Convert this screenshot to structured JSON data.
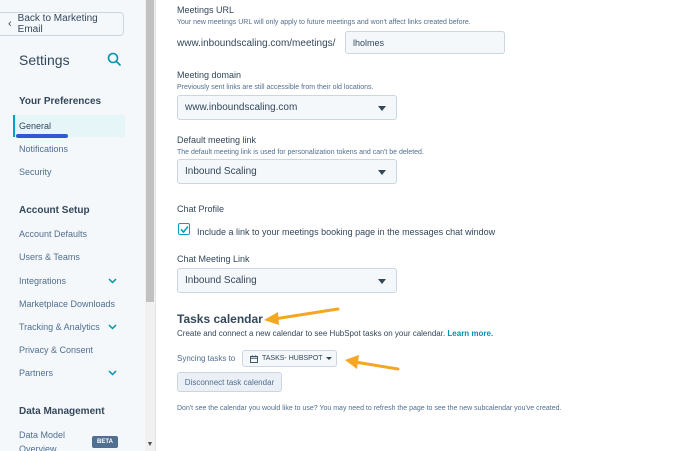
{
  "sidebar": {
    "back_label": "Back to Marketing Email",
    "title": "Settings",
    "sections": {
      "preferences": "Your Preferences",
      "account_setup": "Account Setup",
      "data_management": "Data Management"
    },
    "preferences_items": [
      "General",
      "Notifications",
      "Security"
    ],
    "account_items": [
      "Account Defaults",
      "Users & Teams",
      "Integrations",
      "Marketplace Downloads",
      "Tracking & Analytics",
      "Privacy & Consent",
      "Partners"
    ],
    "data_items": [
      "Data Model",
      "Overview"
    ],
    "beta_badge": "BETA"
  },
  "main": {
    "meetings_url": {
      "label": "Meetings URL",
      "help": "Your new meetings URL will only apply to future meetings and won't affect links created before.",
      "prefix": "www.inboundscaling.com/meetings/",
      "value": "lholmes"
    },
    "meeting_domain": {
      "label": "Meeting domain",
      "help": "Previously sent links are still accessible from their old locations.",
      "value": "www.inboundscaling.com"
    },
    "default_link": {
      "label": "Default meeting link",
      "help": "The default meeting link is used for personalization tokens and can't be deleted.",
      "value": "Inbound Scaling"
    },
    "chat_profile": {
      "label": "Chat Profile",
      "checkbox_label": "Include a link to your meetings booking page in the messages chat window",
      "checked": true
    },
    "chat_link": {
      "label": "Chat Meeting Link",
      "value": "Inbound Scaling"
    },
    "tasks": {
      "title": "Tasks calendar",
      "desc": "Create and connect a new calendar to see HubSpot tasks on your calendar.",
      "learn_more": "Learn more.",
      "sync_label": "Syncing tasks to",
      "calendar_value": "TASKS- HUBSPOT",
      "disconnect_label": "Disconnect task calendar",
      "footnote": "Don't see the calendar you would like to use? You may need to refresh the page to see the new subcalendar you've created."
    }
  },
  "colors": {
    "accent": "#00a4bd",
    "annotation_arrow": "#f5a623",
    "underline": "#2d5bd6"
  }
}
